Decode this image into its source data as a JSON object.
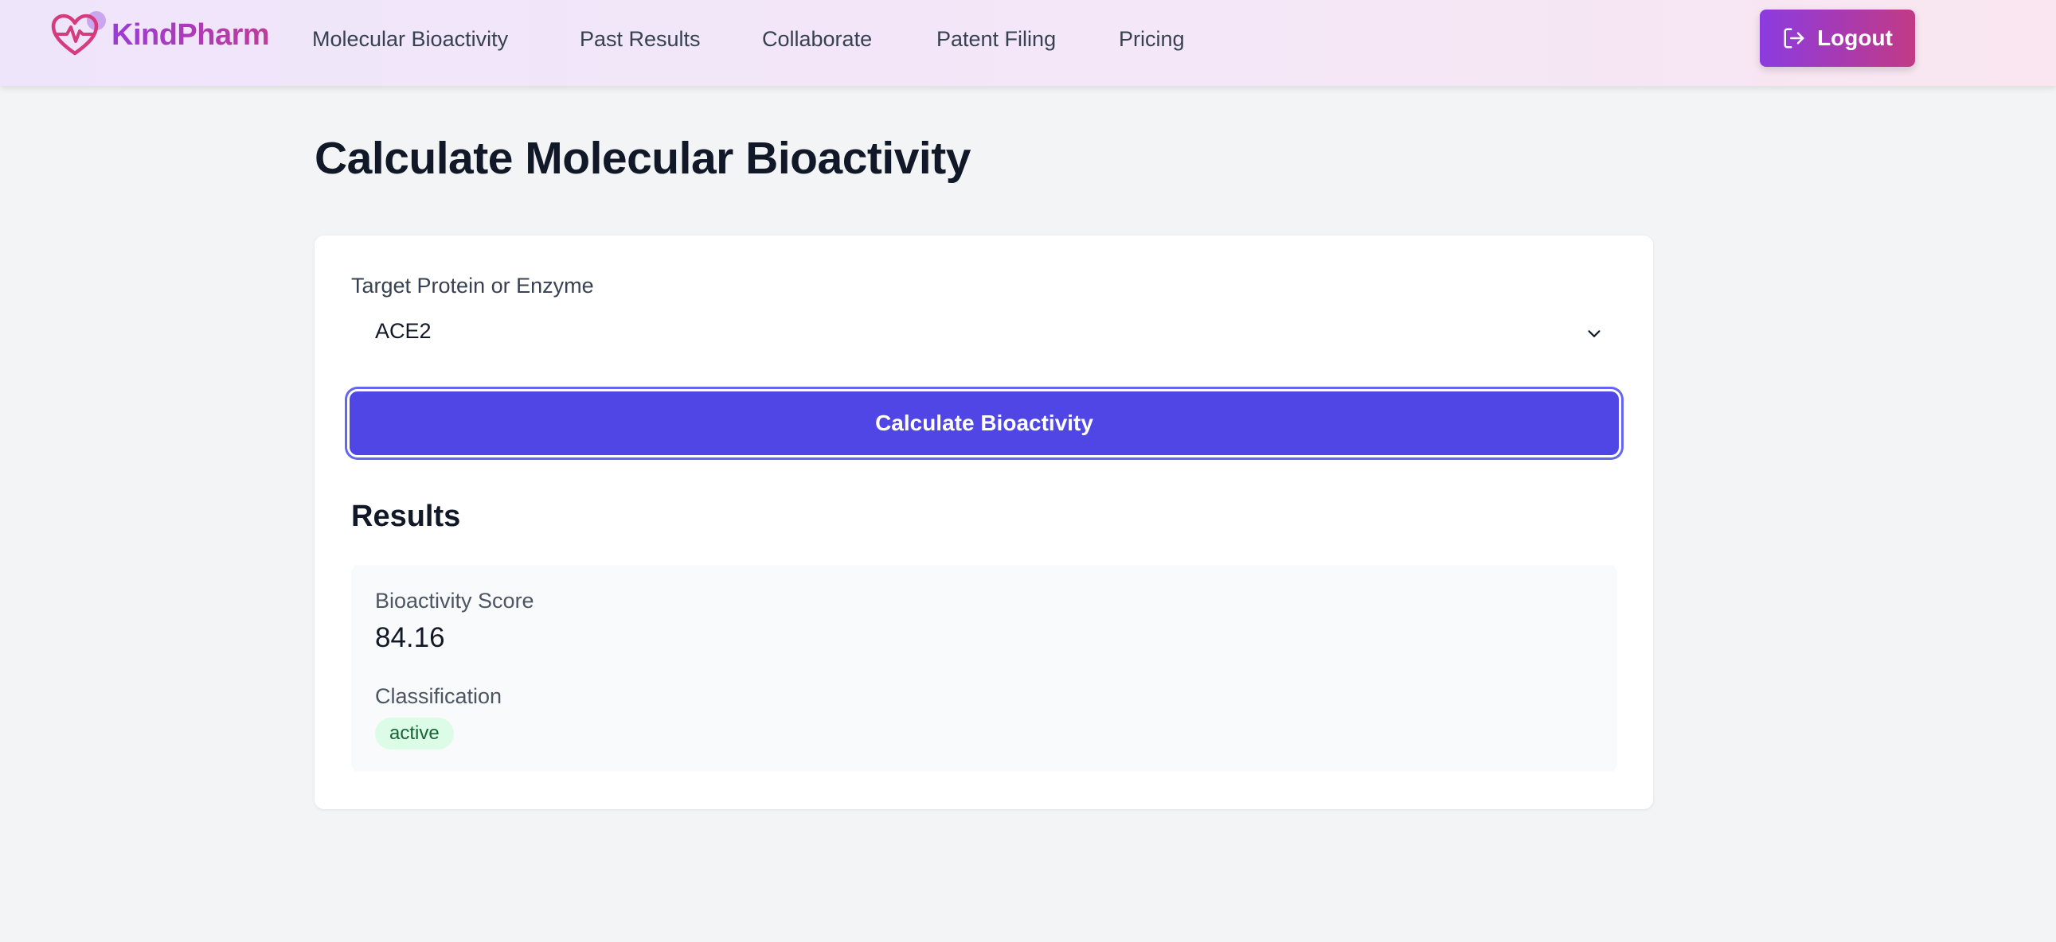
{
  "app": {
    "brand": "KindPharm",
    "logout_label": "Logout"
  },
  "nav": {
    "items": [
      {
        "label": "Molecular Bioactivity"
      },
      {
        "label": "Past Results"
      },
      {
        "label": "Collaborate"
      },
      {
        "label": "Patent Filing"
      },
      {
        "label": "Pricing"
      }
    ]
  },
  "page": {
    "title": "Calculate Molecular Bioactivity"
  },
  "form": {
    "target_label": "Target Protein or Enzyme",
    "target_value": "ACE2",
    "submit_label": "Calculate Bioactivity"
  },
  "results": {
    "title": "Results",
    "score_label": "Bioactivity Score",
    "score_value": "84.16",
    "classification_label": "Classification",
    "classification_value": "active"
  },
  "icons": {
    "logo": "heart-pulse-icon",
    "logout": "logout-icon",
    "select": "chevron-down-icon"
  },
  "colors": {
    "primary": "#4f46e5",
    "brand_start": "#9b3bd6",
    "brand_end": "#c03a9a",
    "badge_bg": "#dcfce7",
    "badge_text": "#166534"
  }
}
